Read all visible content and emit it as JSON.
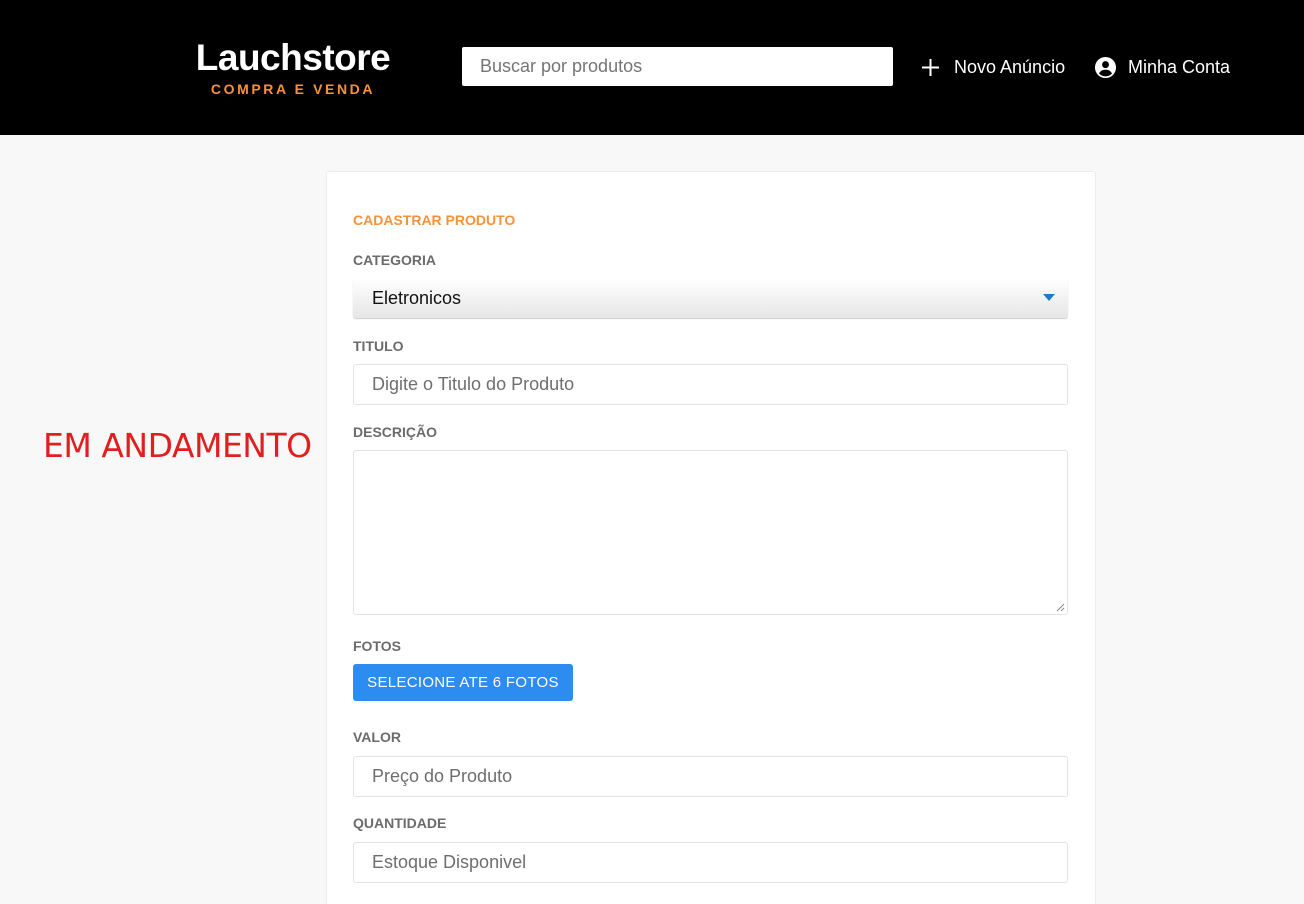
{
  "header": {
    "brand_name": "Lauchstore",
    "brand_tagline": "COMPRA E VENDA",
    "search_placeholder": "Buscar por produtos",
    "new_listing_label": "Novo Anúncio",
    "account_label": "Minha Conta"
  },
  "status_text": "EM ANDAMENTO",
  "form": {
    "title": "CADASTRAR PRODUTO",
    "category_label": "CATEGORIA",
    "category_value": "Eletronicos",
    "title_label": "TITULO",
    "title_placeholder": "Digite o Titulo do Produto",
    "description_label": "DESCRIÇÃO",
    "photos_label": "FOTOS",
    "photos_button": "SELECIONE ATE 6 FOTOS",
    "price_label": "VALOR",
    "price_placeholder": "Preço do Produto",
    "quantity_label": "QUANTIDADE",
    "quantity_placeholder": "Estoque Disponivel"
  },
  "colors": {
    "header_bg": "#000000",
    "accent_orange": "#f7923a",
    "button_blue": "#2d8cf0",
    "status_red": "#e02020",
    "caret_blue": "#1f7ac9"
  },
  "icons": {
    "new_listing": "plus-icon",
    "account": "account-circle-icon",
    "select": "caret-down-icon"
  }
}
